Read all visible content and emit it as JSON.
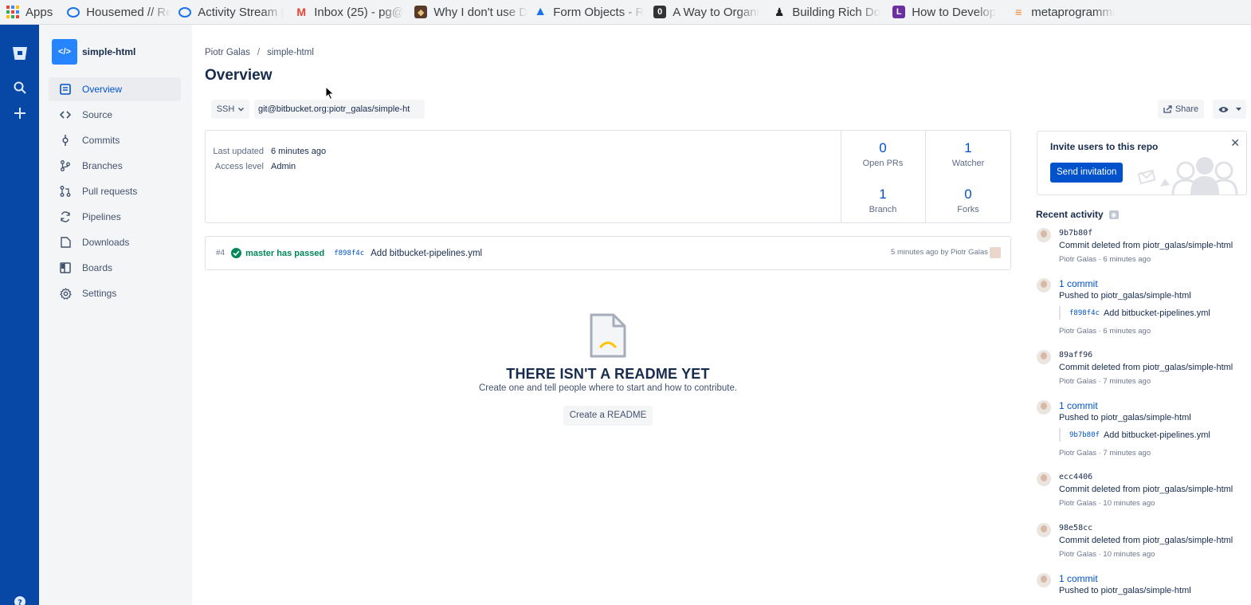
{
  "bookmarks": {
    "apps_label": "Apps",
    "items": [
      {
        "label": "Housemed // Ref",
        "icon": "housemed-icon"
      },
      {
        "label": "Activity Stream |",
        "icon": "activity-stream-icon"
      },
      {
        "label": "Inbox (25) - pg@",
        "icon": "gmail-icon"
      },
      {
        "label": "Why I don't use D",
        "icon": "article-icon"
      },
      {
        "label": "Form Objects - R",
        "icon": "form-objects-icon"
      },
      {
        "label": "A Way to Organi",
        "icon": "medium-icon"
      },
      {
        "label": "Building Rich Do",
        "icon": "blog-icon"
      },
      {
        "label": "How to Develop",
        "icon": "book-icon"
      },
      {
        "label": "metaprogrammi",
        "icon": "stackoverflow-icon"
      }
    ]
  },
  "sidebar": {
    "repo_name": "simple-html",
    "repo_avatar_text": "</>",
    "items": [
      {
        "label": "Overview",
        "icon": "overview-icon"
      },
      {
        "label": "Source",
        "icon": "source-icon"
      },
      {
        "label": "Commits",
        "icon": "commits-icon"
      },
      {
        "label": "Branches",
        "icon": "branches-icon"
      },
      {
        "label": "Pull requests",
        "icon": "pull-requests-icon"
      },
      {
        "label": "Pipelines",
        "icon": "pipelines-icon"
      },
      {
        "label": "Downloads",
        "icon": "downloads-icon"
      },
      {
        "label": "Boards",
        "icon": "boards-icon"
      },
      {
        "label": "Settings",
        "icon": "settings-icon"
      }
    ]
  },
  "header": {
    "breadcrumb": {
      "owner": "Piotr Galas",
      "separator": "/",
      "repo": "simple-html"
    },
    "title": "Overview"
  },
  "clone": {
    "protocol": "SSH",
    "url": "git@bitbucket.org:piotr_galas/simple-ht"
  },
  "actions": {
    "share_label": "Share"
  },
  "info": {
    "last_updated_label": "Last updated",
    "last_updated_value": "6 minutes ago",
    "access_level_label": "Access level",
    "access_level_value": "Admin"
  },
  "stats": {
    "open_prs": {
      "value": "0",
      "label": "Open PRs"
    },
    "watchers": {
      "value": "1",
      "label": "Watcher"
    },
    "branches": {
      "value": "1",
      "label": "Branch"
    },
    "forks": {
      "value": "0",
      "label": "Forks"
    }
  },
  "pipeline": {
    "number": "#4",
    "status": "master has passed",
    "hash": "f898f4c",
    "message": "Add bitbucket-pipelines.yml",
    "meta": "5 minutes ago by Piotr Galas"
  },
  "readme": {
    "title": "THERE ISN'T A README YET",
    "subtitle": "Create one and tell people where to start and how to contribute.",
    "button": "Create a README"
  },
  "invite": {
    "title": "Invite users to this repo",
    "button": "Send invitation"
  },
  "recent_activity": {
    "title": "Recent activity",
    "items": [
      {
        "title": "9b7b80f",
        "desc": "Commit deleted from piotr_galas/simple-html",
        "meta": "Piotr Galas · 6 minutes ago"
      },
      {
        "title": "1 commit",
        "desc": "Pushed to piotr_galas/simple-html",
        "commit_hash": "f898f4c",
        "commit_msg": "Add bitbucket-pipelines.yml",
        "meta": "Piotr Galas · 6 minutes ago"
      },
      {
        "title": "89aff96",
        "desc": "Commit deleted from piotr_galas/simple-html",
        "meta": "Piotr Galas · 7 minutes ago"
      },
      {
        "title": "1 commit",
        "desc": "Pushed to piotr_galas/simple-html",
        "commit_hash": "9b7b80f",
        "commit_msg": "Add bitbucket-pipelines.yml",
        "meta": "Piotr Galas · 7 minutes ago"
      },
      {
        "title": "ecc4406",
        "desc": "Commit deleted from piotr_galas/simple-html",
        "meta": "Piotr Galas · 10 minutes ago"
      },
      {
        "title": "98e58cc",
        "desc": "Commit deleted from piotr_galas/simple-html",
        "meta": "Piotr Galas · 10 minutes ago"
      },
      {
        "title": "1 commit",
        "desc": "Pushed to piotr_galas/simple-html"
      }
    ]
  },
  "colors": {
    "global_nav": "#0747a6",
    "accent": "#0052cc",
    "success": "#00875a",
    "sidebar_bg": "#f4f5f7"
  }
}
